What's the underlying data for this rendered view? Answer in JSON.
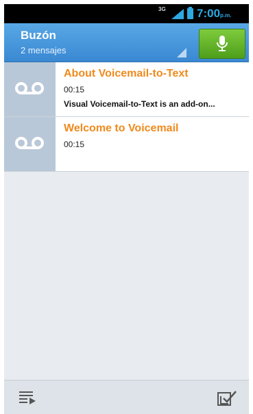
{
  "status_bar": {
    "network": "3G",
    "time": "7:00",
    "ampm": "p.m."
  },
  "header": {
    "title": "Buzón",
    "subtitle": "2 mensajes",
    "mic_icon": "microphone-icon"
  },
  "messages": [
    {
      "title": "About Voicemail-to-Text",
      "duration": "00:15",
      "preview": "Visual Voicemail-to-Text is an add-on..."
    },
    {
      "title": "Welcome to Voicemail",
      "duration": "00:15",
      "preview": ""
    }
  ],
  "bottom_bar": {
    "left_icon": "playlist-icon",
    "right_icon": "select-check-icon"
  },
  "colors": {
    "accent": "#f08a1c",
    "header": "#4a98dc",
    "mic_button": "#5fae28",
    "status_blue": "#2ea8e0"
  }
}
